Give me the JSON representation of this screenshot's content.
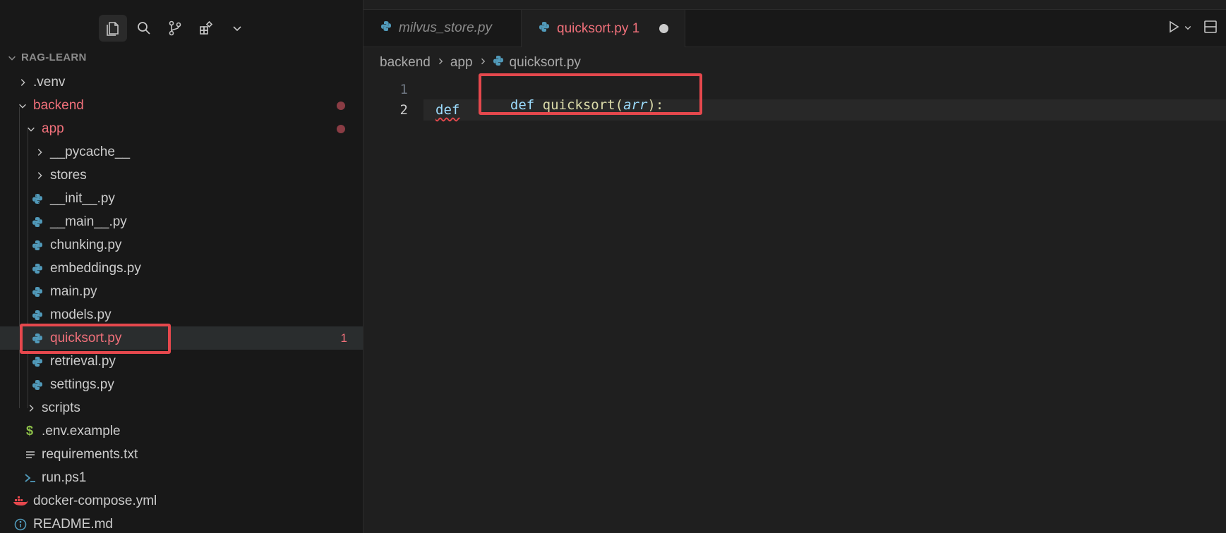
{
  "activity": {
    "icons": [
      "files-icon",
      "search-icon",
      "source-control-icon",
      "extensions-icon",
      "chevron-down-icon"
    ]
  },
  "explorer": {
    "title": "RAG-LEARN",
    "items": [
      {
        "label": ".venv",
        "type": "folder",
        "expanded": false
      },
      {
        "label": "backend",
        "type": "folder",
        "expanded": true,
        "modified": true
      },
      {
        "label": "app",
        "type": "folder",
        "expanded": true,
        "modified": true
      },
      {
        "label": "__pycache__",
        "type": "folder",
        "expanded": false
      },
      {
        "label": "stores",
        "type": "folder",
        "expanded": false
      },
      {
        "label": "__init__.py",
        "type": "python"
      },
      {
        "label": "__main__.py",
        "type": "python"
      },
      {
        "label": "chunking.py",
        "type": "python"
      },
      {
        "label": "embeddings.py",
        "type": "python"
      },
      {
        "label": "main.py",
        "type": "python"
      },
      {
        "label": "models.py",
        "type": "python"
      },
      {
        "label": "quicksort.py",
        "type": "python",
        "problems": "1",
        "selected": true
      },
      {
        "label": "retrieval.py",
        "type": "python"
      },
      {
        "label": "settings.py",
        "type": "python"
      },
      {
        "label": "scripts",
        "type": "folder",
        "expanded": false
      },
      {
        "label": ".env.example",
        "type": "env"
      },
      {
        "label": "requirements.txt",
        "type": "text"
      },
      {
        "label": "run.ps1",
        "type": "powershell"
      },
      {
        "label": "docker-compose.yml",
        "type": "docker"
      },
      {
        "label": "README.md",
        "type": "info"
      }
    ]
  },
  "tabs": [
    {
      "label": "milvus_store.py",
      "active": false
    },
    {
      "label": "quicksort.py 1",
      "active": true,
      "unsaved": true
    }
  ],
  "breadcrumb": [
    "backend",
    "app",
    "quicksort.py"
  ],
  "editor": {
    "line_numbers": [
      "1",
      "2"
    ],
    "ghost_suggestion": {
      "keyword": "def",
      "name": "quicksort",
      "open": "(",
      "param": "arr",
      "close": "):"
    },
    "line2_text": "def"
  },
  "colors": {
    "accent_modified": "#f0707a",
    "highlight_box": "#e5484d",
    "python_icon": "#519aba"
  }
}
